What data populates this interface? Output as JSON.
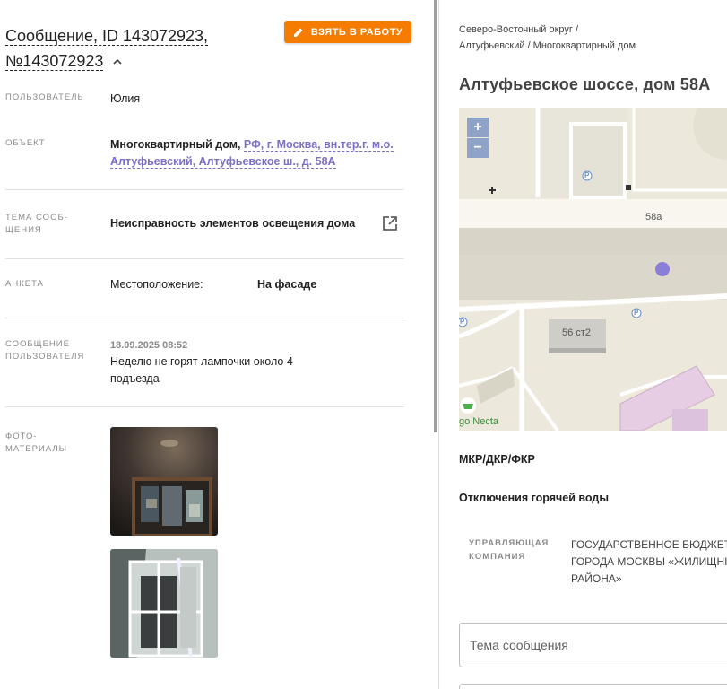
{
  "header": {
    "title_line1": "Сообщение, ID 143072923,",
    "title_line2": "№143072923",
    "take_button": "ВЗЯТЬ В РАБОТУ"
  },
  "fields": {
    "user_label": "ПОЛЬЗОВАТЕЛЬ",
    "user_value": "Юлия",
    "object_label": "ОБЪЕКТ",
    "object_type": "Многоквартирный дом, ",
    "object_link_1": "РФ, г. Москва, вн.тер.г. м.о.",
    "object_link_2": "Алтуфьевский, Алтуфьевское ш., д. 58А",
    "topic_label_1": "ТЕМА СООБ-",
    "topic_label_2": "ЩЕНИЯ",
    "topic_value": "Неисправность элементов освещения дома",
    "survey_label": "АНКЕТА",
    "survey_key": "Местоположение:",
    "survey_value": "На фасаде",
    "msg_label_1": "СООБЩЕНИЕ",
    "msg_label_2": "ПОЛЬЗОВАТЕЛЯ",
    "msg_date": "18.09.2025 08:52",
    "msg_text_1": "Неделю не горят лампочки около 4",
    "msg_text_2": "подъезда",
    "photo_label_1": "ФОТО-",
    "photo_label_2": "МАТЕРИАЛЫ"
  },
  "right": {
    "crumb_1": "Северо-Восточный округ /",
    "crumb_2": "Алтуфьевский / Многоквартирный дом",
    "address": "Алтуфьевское шоссе, дом 58А",
    "map": {
      "zoom_in": "+",
      "zoom_out": "−",
      "label_58a": "58а",
      "label_56": "56 ст2",
      "label_shop": "go Necta",
      "parking": "P"
    },
    "mkr": "МКР/ДКР/ФКР",
    "hot_water": "Отключения горячей воды",
    "uk_label_1": "УПРАВЛЯЮЩАЯ",
    "uk_label_2": "КОМПАНИЯ",
    "uk_value_1": "ГОСУДАРСТВЕННОЕ БЮДЖЕТ",
    "uk_value_2": "ГОРОДА МОСКВЫ «ЖИЛИЩНІ",
    "uk_value_3": "РАЙОНА»",
    "topic_placeholder": "Тема сообщения"
  },
  "colors": {
    "accent": "#f57c00",
    "link": "#7e6fc4",
    "marker": "#8a7fd8"
  }
}
